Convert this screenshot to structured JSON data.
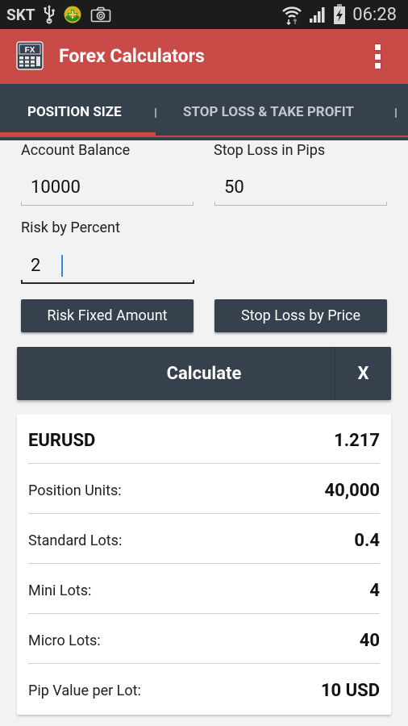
{
  "status_bar": {
    "carrier": "SKT",
    "left_icons": [
      "usb-icon",
      "notification-app-icon",
      "camera-icon"
    ],
    "right_icons": [
      "wifi-icon",
      "signal-icon",
      "battery-charging-icon"
    ],
    "time": "06:28"
  },
  "app_bar": {
    "title": "Forex Calculators",
    "logo_text": "FX",
    "menu_icon": "overflow-menu-icon"
  },
  "tabs": [
    {
      "label": "Position Size",
      "active": true
    },
    {
      "label": "Stop Loss & Take Profit",
      "active": false
    }
  ],
  "colors": {
    "accent": "#c94b48",
    "dark": "#37414e",
    "background": "#f2f2f2",
    "caret": "#2f8bd8"
  },
  "form": {
    "account_balance": {
      "label": "Account Balance",
      "value": "10000"
    },
    "stop_loss_pips": {
      "label": "Stop Loss in Pips",
      "value": "50"
    },
    "risk_percent": {
      "label": "Risk by Percent",
      "value": "2"
    },
    "risk_fixed_button": "Risk Fixed Amount",
    "stop_loss_price_button": "Stop Loss by Price",
    "calculate_button": "Calculate",
    "clear_button": "X"
  },
  "results": {
    "pair": "EURUSD",
    "rate": "1.217",
    "rows": [
      {
        "label": "Position Units:",
        "value": "40,000"
      },
      {
        "label": "Standard Lots:",
        "value": "0.4"
      },
      {
        "label": "Mini Lots:",
        "value": "4"
      },
      {
        "label": "Micro Lots:",
        "value": "40"
      },
      {
        "label": "Pip Value per Lot:",
        "value": "10 USD"
      }
    ]
  }
}
